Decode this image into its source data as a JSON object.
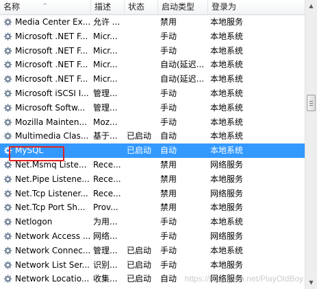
{
  "columns": {
    "name": "名称",
    "description": "描述",
    "status": "状态",
    "startup_type": "启动类型",
    "logon_as": "登录为"
  },
  "rows": [
    {
      "name": "Media Center Ex...",
      "description": "允许 ...",
      "status": "",
      "startup_type": "禁用",
      "logon_as": "本地服务",
      "selected": false
    },
    {
      "name": "Microsoft .NET F...",
      "description": "Micr...",
      "status": "",
      "startup_type": "手动",
      "logon_as": "本地系统",
      "selected": false
    },
    {
      "name": "Microsoft .NET F...",
      "description": "Micr...",
      "status": "",
      "startup_type": "手动",
      "logon_as": "本地系统",
      "selected": false
    },
    {
      "name": "Microsoft .NET F...",
      "description": "Micr...",
      "status": "",
      "startup_type": "自动(延迟...",
      "logon_as": "本地系统",
      "selected": false
    },
    {
      "name": "Microsoft .NET F...",
      "description": "Micr...",
      "status": "",
      "startup_type": "自动(延迟...",
      "logon_as": "本地系统",
      "selected": false
    },
    {
      "name": "Microsoft iSCSI I...",
      "description": "管理...",
      "status": "",
      "startup_type": "手动",
      "logon_as": "本地系统",
      "selected": false
    },
    {
      "name": "Microsoft Softw...",
      "description": "管理...",
      "status": "",
      "startup_type": "手动",
      "logon_as": "本地系统",
      "selected": false
    },
    {
      "name": "Mozilla Mainten...",
      "description": "Moz...",
      "status": "",
      "startup_type": "手动",
      "logon_as": "本地系统",
      "selected": false
    },
    {
      "name": "Multimedia Clas...",
      "description": "基于...",
      "status": "已启动",
      "startup_type": "自动",
      "logon_as": "本地系统",
      "selected": false
    },
    {
      "name": "MySQL",
      "description": "",
      "status": "已启动",
      "startup_type": "自动",
      "logon_as": "本地系统",
      "selected": true
    },
    {
      "name": "Net.Msmq Liste...",
      "description": "Rece...",
      "status": "",
      "startup_type": "禁用",
      "logon_as": "网络服务",
      "selected": false
    },
    {
      "name": "Net.Pipe Listene...",
      "description": "Rece...",
      "status": "",
      "startup_type": "禁用",
      "logon_as": "本地服务",
      "selected": false
    },
    {
      "name": "Net.Tcp Listener...",
      "description": "Rece...",
      "status": "",
      "startup_type": "禁用",
      "logon_as": "网络服务",
      "selected": false
    },
    {
      "name": "Net.Tcp Port Sh...",
      "description": "Prov...",
      "status": "",
      "startup_type": "禁用",
      "logon_as": "本地服务",
      "selected": false
    },
    {
      "name": "Netlogon",
      "description": "为用...",
      "status": "",
      "startup_type": "手动",
      "logon_as": "本地系统",
      "selected": false
    },
    {
      "name": "Network Access ...",
      "description": "网络...",
      "status": "",
      "startup_type": "手动",
      "logon_as": "网络服务",
      "selected": false
    },
    {
      "name": "Network Connec...",
      "description": "管理...",
      "status": "已启动",
      "startup_type": "手动",
      "logon_as": "本地系统",
      "selected": false
    },
    {
      "name": "Network List Ser...",
      "description": "识别...",
      "status": "已启动",
      "startup_type": "手动",
      "logon_as": "本地服务",
      "selected": false
    },
    {
      "name": "Network Locatio...",
      "description": "收集...",
      "status": "已启动",
      "startup_type": "自动",
      "logon_as": "网络服务",
      "selected": false
    }
  ],
  "watermark": "https://blog.csdn.net/PlayOldBoy",
  "colors": {
    "selection": "#3399ff",
    "highlight_box": "#e02020",
    "gear_icon": "#6f7f96"
  },
  "icons": {
    "row_icon": "gear-icon",
    "sort_indicator": "sort-ascending-icon"
  }
}
